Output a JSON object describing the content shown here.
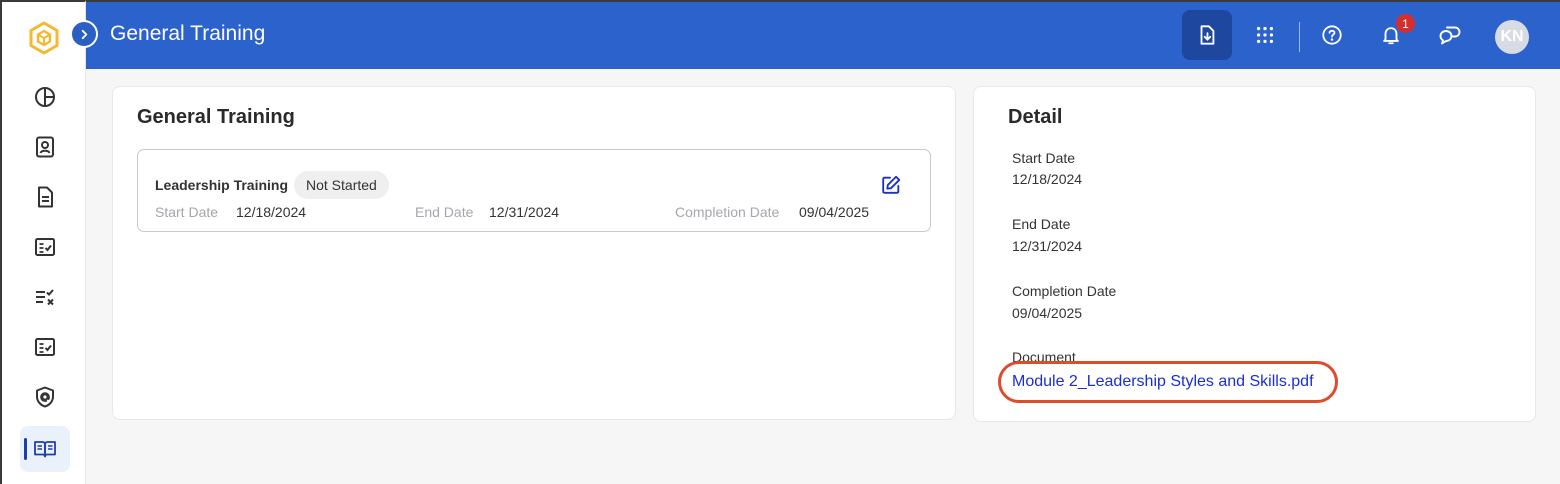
{
  "header": {
    "title": "General Training",
    "notification_count": "1",
    "avatar_initials": "KN"
  },
  "sidebar": {
    "items": [
      {
        "icon": "pie-chart-icon"
      },
      {
        "icon": "contact-card-icon"
      },
      {
        "icon": "document-icon"
      },
      {
        "icon": "checklist-icon"
      },
      {
        "icon": "list-check-x-icon"
      },
      {
        "icon": "checklist-icon"
      },
      {
        "icon": "shield-at-icon"
      },
      {
        "icon": "book-open-icon",
        "active": true
      }
    ]
  },
  "main": {
    "title": "General Training",
    "trainings": [
      {
        "name": "Leadership Training",
        "status": "Not Started",
        "start_label": "Start Date",
        "start_value": "12/18/2024",
        "end_label": "End Date",
        "end_value": "12/31/2024",
        "completion_label": "Completion Date",
        "completion_value": "09/04/2025"
      }
    ]
  },
  "detail": {
    "title": "Detail",
    "start_label": "Start Date",
    "start_value": "12/18/2024",
    "end_label": "End Date",
    "end_value": "12/31/2024",
    "completion_label": "Completion Date",
    "completion_value": "09/04/2025",
    "document_label": "Document",
    "document_link": "Module 2_Leadership Styles and Skills.pdf"
  },
  "colors": {
    "header_bg": "#2b62cc",
    "link": "#1a2fd0",
    "highlight": "#e04a2d",
    "badge": "#d32f2f"
  }
}
